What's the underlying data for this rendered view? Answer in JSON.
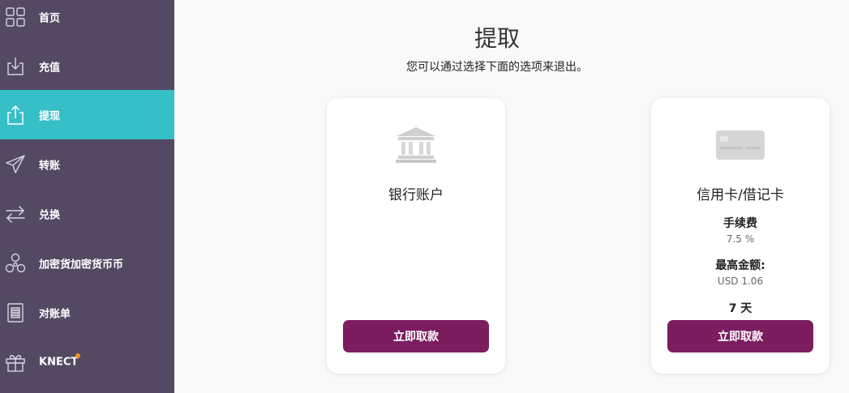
{
  "sidebar": {
    "items": [
      {
        "label": "首页",
        "icon": "grid-icon",
        "active": false
      },
      {
        "label": "充值",
        "icon": "download-icon",
        "active": false
      },
      {
        "label": "提现",
        "icon": "upload-icon",
        "active": true
      },
      {
        "label": "转账",
        "icon": "send-icon",
        "active": false
      },
      {
        "label": "兑换",
        "icon": "swap-icon",
        "active": false
      },
      {
        "label": "加密货加密货币币",
        "icon": "molecule-icon",
        "active": false
      },
      {
        "label": "对账单",
        "icon": "statement-icon",
        "active": false
      },
      {
        "label": "KNECT",
        "icon": "gift-icon",
        "active": false,
        "badge": true
      }
    ]
  },
  "main": {
    "title": "提取",
    "subtitle": "您可以通过选择下面的选项来退出。",
    "cards": [
      {
        "icon": "bank-icon",
        "title": "银行账户",
        "button_label": "立即取款"
      },
      {
        "icon": "credit-card-icon",
        "title": "信用卡/借记卡",
        "fee_label": "手续费",
        "fee_value": "7.5 %",
        "max_label": "最高金额:",
        "max_value": "USD 1.06",
        "days_label": "7 天",
        "button_label": "立即取款"
      }
    ]
  },
  "colors": {
    "sidebar_bg": "#544963",
    "active_bg": "#36bfc6",
    "button_bg": "#7c1d60",
    "badge": "#f7941d",
    "page_bg": "#f9f9f9"
  }
}
